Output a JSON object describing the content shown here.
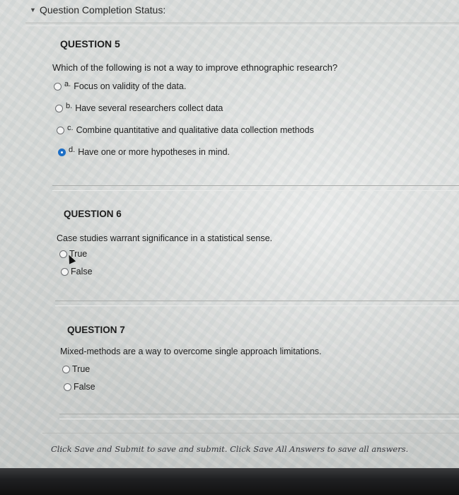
{
  "status": {
    "label": "Question Completion Status:"
  },
  "questions": [
    {
      "title": "QUESTION 5",
      "text": "Which of the following is not a way to improve ethnographic research?",
      "options": [
        {
          "letter": "a.",
          "text": "Focus on validity of the data.",
          "selected": false
        },
        {
          "letter": "b.",
          "text": "Have several researchers collect data",
          "selected": false
        },
        {
          "letter": "c.",
          "text": "Combine quantitative and qualitative data collection methods",
          "selected": false
        },
        {
          "letter": "d.",
          "text": "Have one or more hypotheses in mind.",
          "selected": true
        }
      ]
    },
    {
      "title": "QUESTION 6",
      "text": "Case studies warrant significance in a statistical sense.",
      "options": [
        {
          "text": "True",
          "selected": false
        },
        {
          "text": "False",
          "selected": false
        }
      ]
    },
    {
      "title": "QUESTION 7",
      "text": "Mixed-methods are a way to overcome single approach limitations.",
      "options": [
        {
          "text": "True",
          "selected": false
        },
        {
          "text": "False",
          "selected": false
        }
      ]
    }
  ],
  "footer": {
    "text": "Click Save and Submit to save and submit. Click Save All Answers to save all answers."
  },
  "colors": {
    "selected_radio": "#1d6fc6",
    "background": "#d3d5d3"
  },
  "icons": {
    "collapse": "chevron-down-icon"
  }
}
